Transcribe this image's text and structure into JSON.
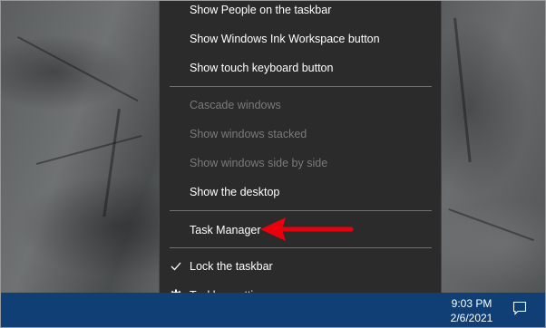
{
  "menu": {
    "items": [
      {
        "label": "Show People on the taskbar",
        "enabled": true
      },
      {
        "label": "Show Windows Ink Workspace button",
        "enabled": true
      },
      {
        "label": "Show touch keyboard button",
        "enabled": true
      },
      {
        "label": "Cascade windows",
        "enabled": false
      },
      {
        "label": "Show windows stacked",
        "enabled": false
      },
      {
        "label": "Show windows side by side",
        "enabled": false
      },
      {
        "label": "Show the desktop",
        "enabled": true
      },
      {
        "label": "Task Manager",
        "enabled": true
      },
      {
        "label": "Lock the taskbar",
        "enabled": true,
        "checked": true,
        "icon": "check-icon"
      },
      {
        "label": "Taskbar settings",
        "enabled": true,
        "icon": "gear-icon"
      }
    ]
  },
  "taskbar": {
    "time": "9:03 PM",
    "date": "2/6/2021",
    "notification_icon": "action-center-icon"
  },
  "annotation": {
    "arrow_color": "#e8000b",
    "target": "Task Manager"
  },
  "colors": {
    "menu_bg": "#2b2b2b",
    "taskbar_bg": "#0f3f74"
  }
}
